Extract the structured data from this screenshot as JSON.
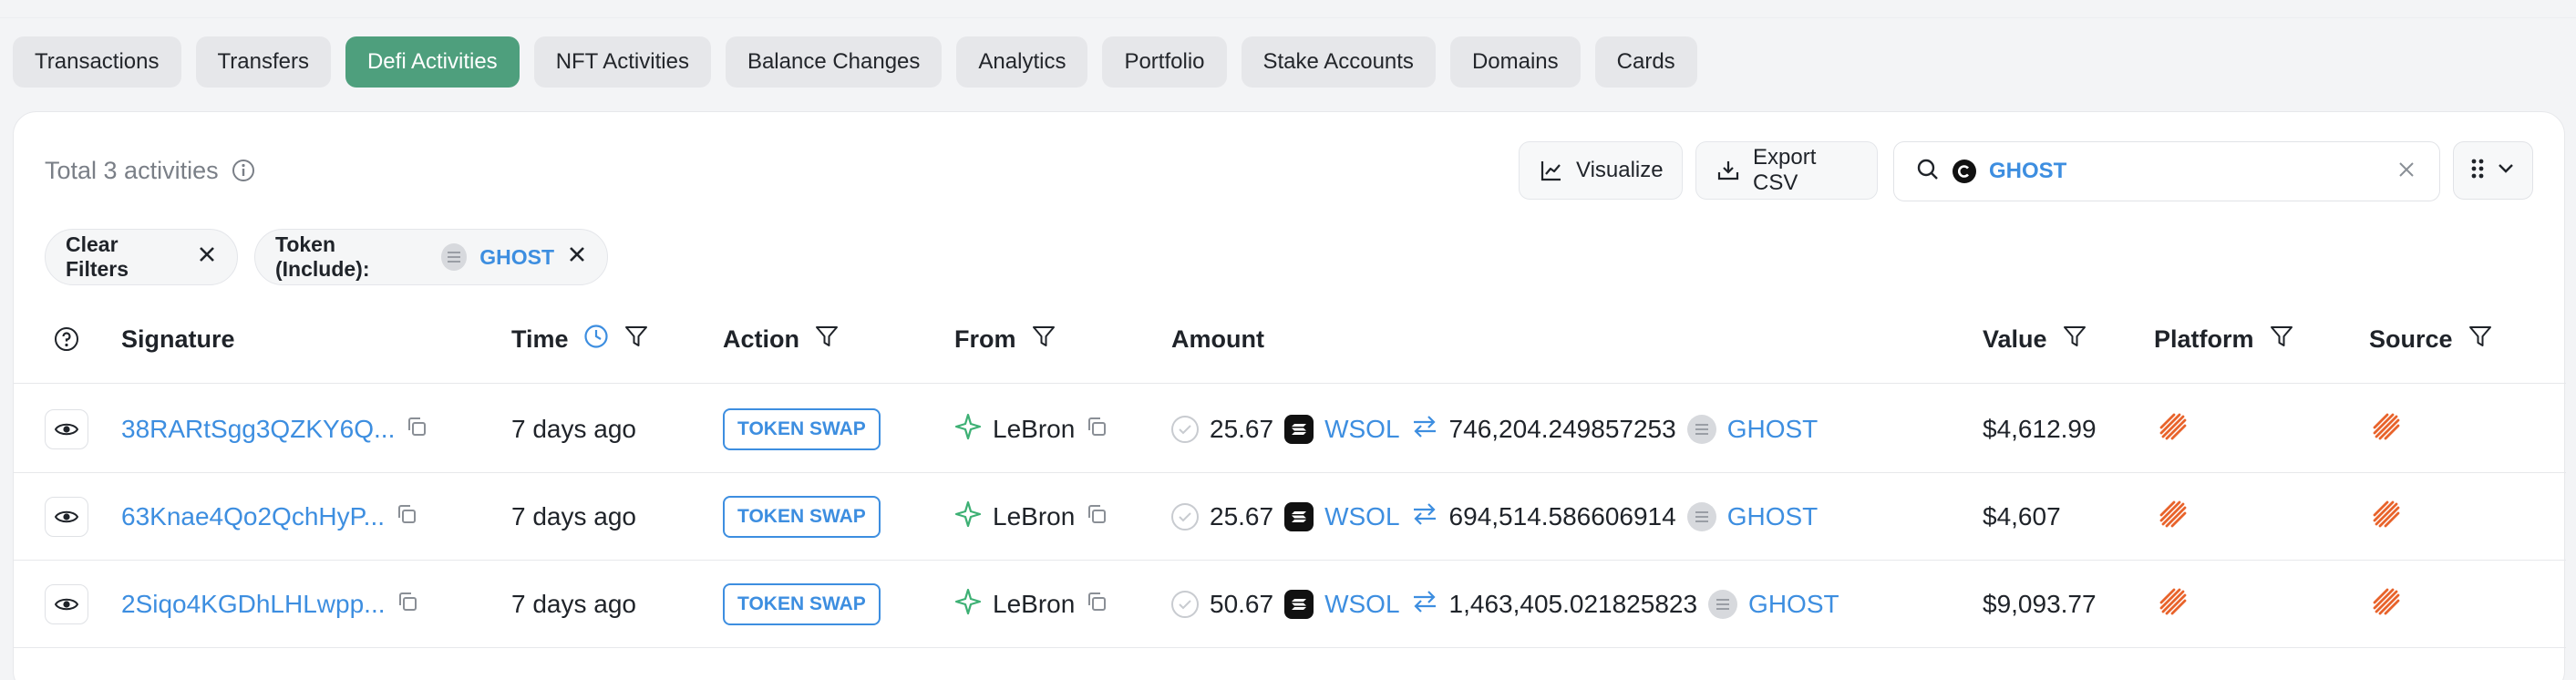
{
  "tabs": [
    {
      "label": "Transactions",
      "active": false
    },
    {
      "label": "Transfers",
      "active": false
    },
    {
      "label": "Defi Activities",
      "active": true
    },
    {
      "label": "NFT Activities",
      "active": false
    },
    {
      "label": "Balance Changes",
      "active": false
    },
    {
      "label": "Analytics",
      "active": false
    },
    {
      "label": "Portfolio",
      "active": false
    },
    {
      "label": "Stake Accounts",
      "active": false
    },
    {
      "label": "Domains",
      "active": false
    },
    {
      "label": "Cards",
      "active": false
    }
  ],
  "toolbar": {
    "total_text": "Total 3 activities",
    "visualize_label": "Visualize",
    "export_label": "Export CSV",
    "search_value": "GHOST"
  },
  "filters": {
    "clear_label": "Clear Filters",
    "token_label": "Token (Include):",
    "token_value": "GHOST"
  },
  "columns": {
    "signature": "Signature",
    "time": "Time",
    "action": "Action",
    "from": "From",
    "amount": "Amount",
    "value": "Value",
    "platform": "Platform",
    "source": "Source"
  },
  "rows": [
    {
      "signature": "38RARtSgg3QZKY6Q...",
      "time": "7 days ago",
      "action": "TOKEN SWAP",
      "from": "LeBron",
      "amount_in": "25.67",
      "token_in": "WSOL",
      "amount_out": "746,204.249857253",
      "token_out": "GHOST",
      "value": "$4,612.99"
    },
    {
      "signature": "63Knae4Qo2QchHyP...",
      "time": "7 days ago",
      "action": "TOKEN SWAP",
      "from": "LeBron",
      "amount_in": "25.67",
      "token_in": "WSOL",
      "amount_out": "694,514.586606914",
      "token_out": "GHOST",
      "value": "$4,607"
    },
    {
      "signature": "2Siqo4KGDhLHLwpp...",
      "time": "7 days ago",
      "action": "TOKEN SWAP",
      "from": "LeBron",
      "amount_in": "50.67",
      "token_in": "WSOL",
      "amount_out": "1,463,405.021825823",
      "token_out": "GHOST",
      "value": "$9,093.77"
    }
  ],
  "colors": {
    "accent_green": "#4e9f7d",
    "link_blue": "#3d8ee0",
    "platform_orange": "#e8632b"
  }
}
